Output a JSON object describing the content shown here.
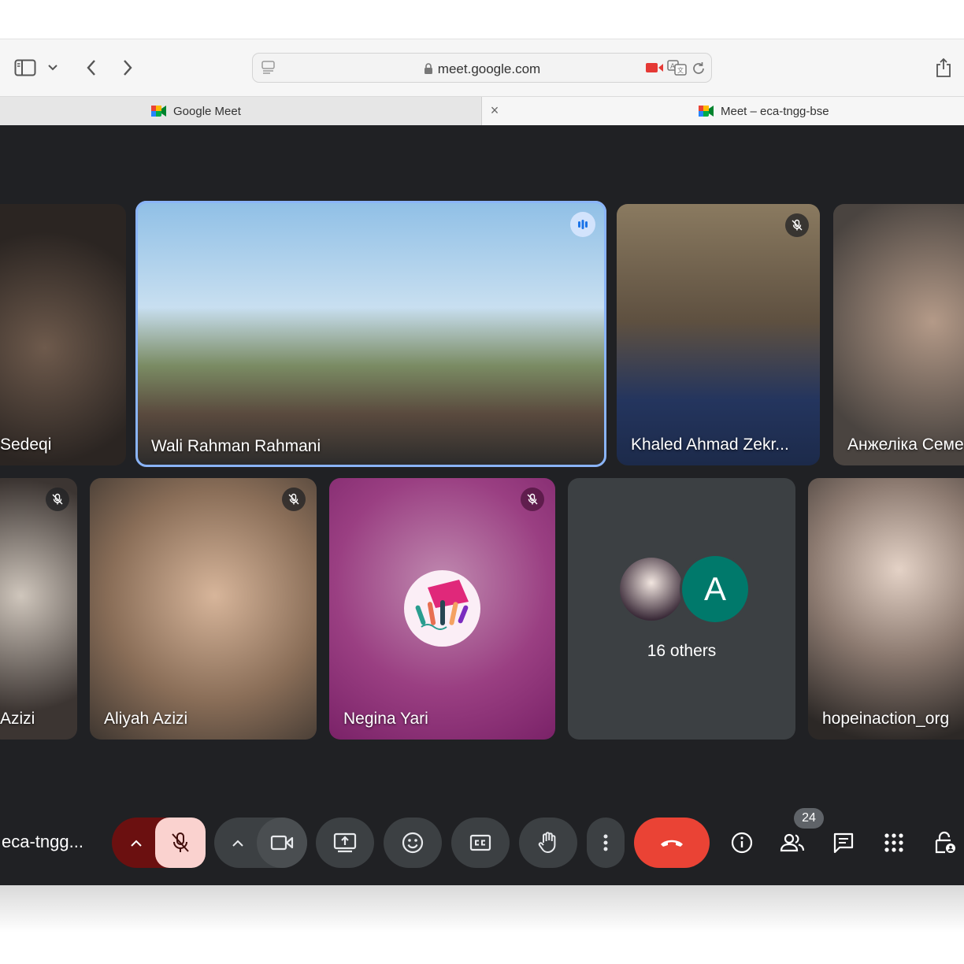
{
  "browser": {
    "url": "meet.google.com",
    "tabs": [
      {
        "label": "Google Meet"
      },
      {
        "label": "Meet – eca-tngg-bse"
      }
    ],
    "tab_close": "×"
  },
  "participants": {
    "p1_name": "Sedeqi",
    "p2_name": "Wali Rahman Rahmani",
    "p3_name": "Khaled Ahmad Zekr...",
    "p4_name": "Анжеліка Семе",
    "p5_name": "Azizi",
    "p6_name": "Aliyah Azizi",
    "p7_name": "Negina Yari",
    "others_label": "16 others",
    "others_initial": "A",
    "p8_name": "hopeinaction_org"
  },
  "controls": {
    "meeting_code": "eca-tngg...",
    "people_count": "24"
  },
  "colors": {
    "stage_bg": "#202124",
    "end_call": "#ea4335",
    "mic_muted_bg": "#fad2cf",
    "mic_arrow_bg": "#6b1010",
    "speaking_outline": "#8ab4f8",
    "avatar_teal": "#00796b"
  },
  "icons": [
    "sidebar-icon",
    "chevron-down-icon",
    "back-icon",
    "forward-icon",
    "reader-icon",
    "lock-icon",
    "camera-recording-icon",
    "translate-icon",
    "reload-icon",
    "share-icon",
    "meet-icon",
    "mic-off-icon",
    "camera-icon",
    "present-icon",
    "emoji-icon",
    "captions-icon",
    "raise-hand-icon",
    "more-icon",
    "end-call-icon",
    "info-icon",
    "people-icon",
    "chat-icon",
    "activities-icon",
    "host-controls-icon"
  ]
}
